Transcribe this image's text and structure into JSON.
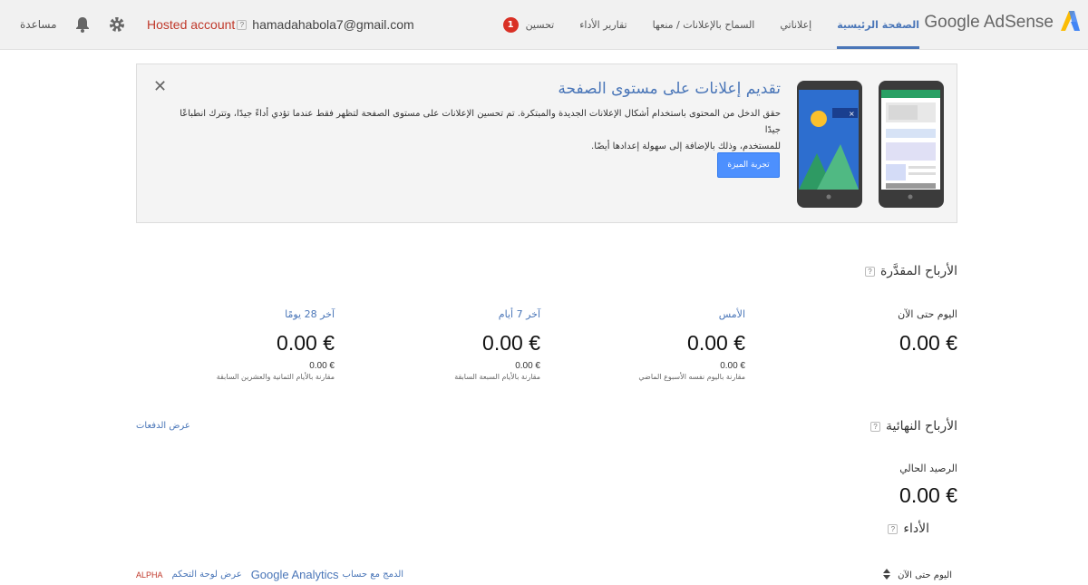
{
  "header": {
    "help": "مساعدة",
    "hosted_account": "Hosted account",
    "qmark": "?",
    "email": "hamadahabola7@gmail.com",
    "nav": [
      {
        "label": "الصفحة الرئيسية",
        "active": true
      },
      {
        "label": "إعلاناتي"
      },
      {
        "label": "السماح بالإعلانات / منعها"
      },
      {
        "label": "تقارير الأداء"
      },
      {
        "label": "تحسين"
      }
    ],
    "optimize_badge": "1",
    "brand": "Google AdSense"
  },
  "promo": {
    "close": "✕",
    "title": "تقديم إعلانات على مستوى الصفحة",
    "body_line1": "حقق الدخل من المحتوى باستخدام أشكال الإعلانات الجديدة والمبتكرة. تم تحسين الإعلانات على مستوى الصفحة لتظهر فقط عندما تؤدي أداءً جيدًا، وتترك انطباعًا جيدًا",
    "body_line2": "للمستخدم، وذلك بالإضافة إلى سهولة إعدادها أيضًا.",
    "button": "تجربة الميزة"
  },
  "estimated": {
    "title": "الأرباح المقدَّرة",
    "metrics": [
      {
        "label": "اليوم حتى الآن",
        "value": "0.00 €"
      },
      {
        "label": "الأمس",
        "value": "0.00 €",
        "sub": "0.00 €",
        "cmp": "مقارنة باليوم نفسه الأسبوع الماضي"
      },
      {
        "label": "آخر 7 أيام",
        "value": "0.00 €",
        "sub": "0.00 €",
        "cmp": "مقارنة بالأيام السبعة السابقة"
      },
      {
        "label": "آخر 28 يومًا",
        "value": "0.00 €",
        "sub": "0.00 €",
        "cmp": "مقارنة بالأيام الثمانية والعشرين السابقة"
      }
    ]
  },
  "finalized": {
    "title": "الأرباح النهائية",
    "view_payments": "عرض الدفعات",
    "balance_label": "الرصيد الحالي",
    "balance_value": "0.00 €"
  },
  "performance": {
    "title": "الأداء",
    "range": "اليوم حتى الآن",
    "alpha": "ALPHA",
    "dashboard_link": "عرض لوحة التحكم",
    "ga_name": "Google Analytics",
    "ga_link": "الدمج مع حساب"
  },
  "colors": {
    "accent": "#4a76b8",
    "danger": "#d93025",
    "button": "#4d90fe"
  }
}
